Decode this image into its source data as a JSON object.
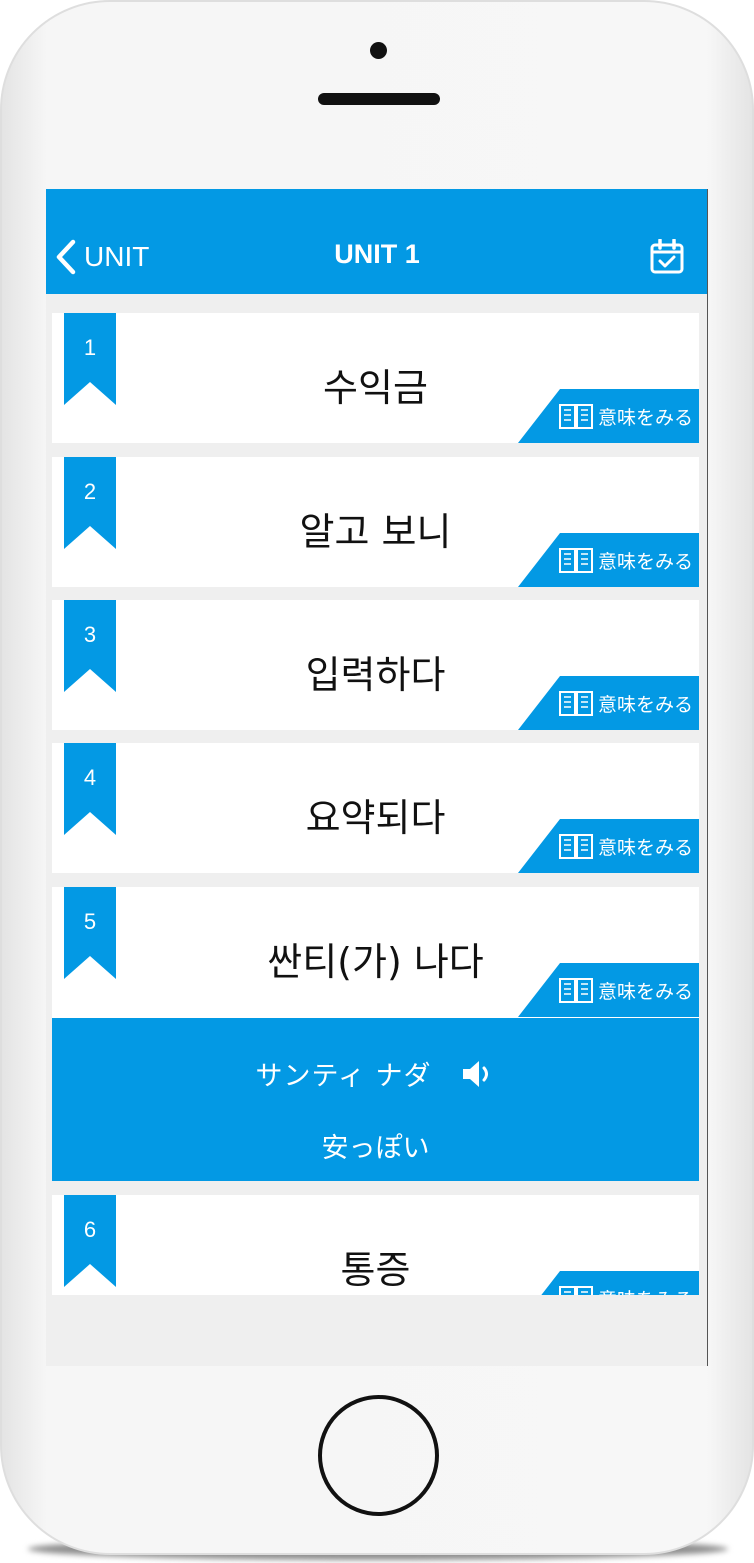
{
  "nav": {
    "back_label": "UNIT",
    "title": "UNIT 1",
    "calendar_icon": "calendar-check-icon"
  },
  "theme": {
    "accent": "#0399e4",
    "card_bg": "#ffffff",
    "list_bg": "#efefef"
  },
  "words": [
    {
      "number": "1",
      "word": "수익금",
      "meaning_label": "意味をみる"
    },
    {
      "number": "2",
      "word": "알고 보니",
      "meaning_label": "意味をみる"
    },
    {
      "number": "3",
      "word": "입력하다",
      "meaning_label": "意味をみる"
    },
    {
      "number": "4",
      "word": "요약되다",
      "meaning_label": "意味をみる"
    },
    {
      "number": "5",
      "word": "싼티(가) 나다",
      "meaning_label": "意味をみる"
    },
    {
      "number": "6",
      "word": "통증",
      "meaning_label": "意味をみる"
    }
  ],
  "expanded": {
    "reading": "サンティ ナダ",
    "translation": "安っぽい",
    "sound_icon": "speaker-icon"
  }
}
